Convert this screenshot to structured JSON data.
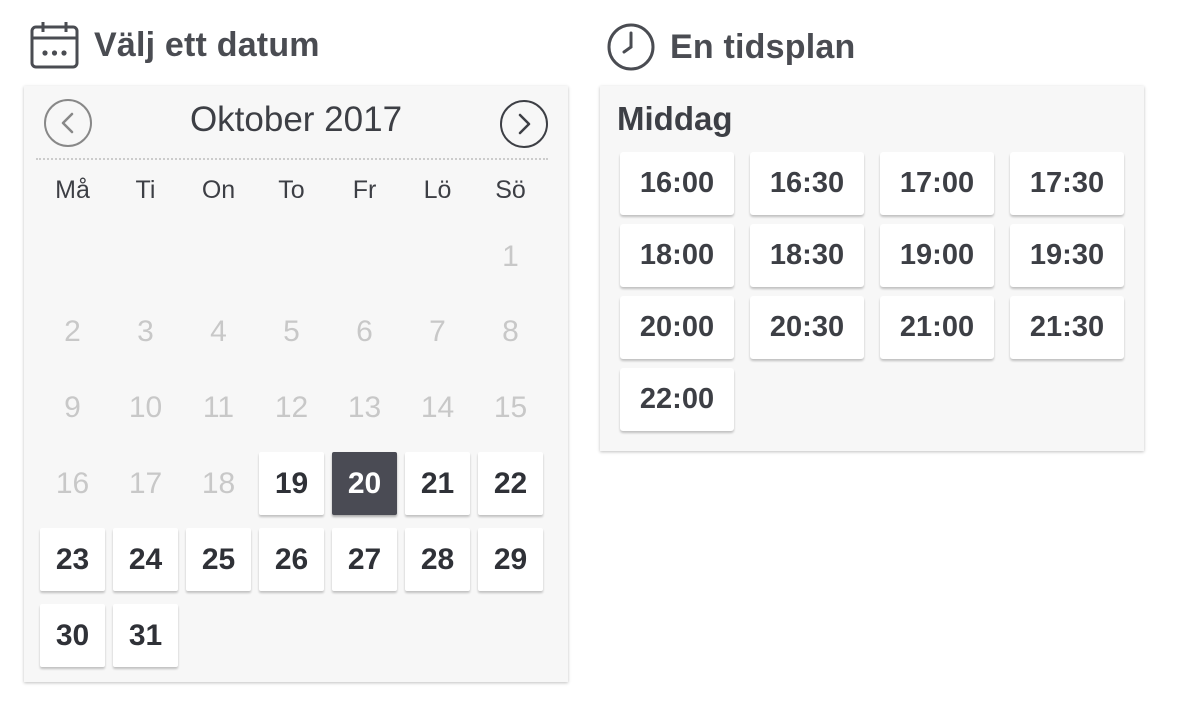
{
  "date_section": {
    "title": "Välj ett datum",
    "icon": "calendar-icon"
  },
  "time_section": {
    "title": "En tidsplan",
    "icon": "clock-icon"
  },
  "calendar": {
    "month_label": "Oktober 2017",
    "prev_icon": "chevron-left-icon",
    "next_icon": "chevron-right-icon",
    "weekdays": [
      "Må",
      "Ti",
      "On",
      "To",
      "Fr",
      "Lö",
      "Sö"
    ],
    "first_weekday_index": 6,
    "days_in_month": 31,
    "first_available_day": 19,
    "selected_day": 20
  },
  "timeslots": {
    "group_label": "Middag",
    "slots": [
      "16:00",
      "16:30",
      "17:00",
      "17:30",
      "18:00",
      "18:30",
      "19:00",
      "19:30",
      "20:00",
      "20:30",
      "21:00",
      "21:30",
      "22:00"
    ]
  },
  "colors": {
    "selected_bg": "#4a4b54",
    "panel_bg": "#f7f7f7",
    "disabled_text": "#c8c8c8"
  }
}
